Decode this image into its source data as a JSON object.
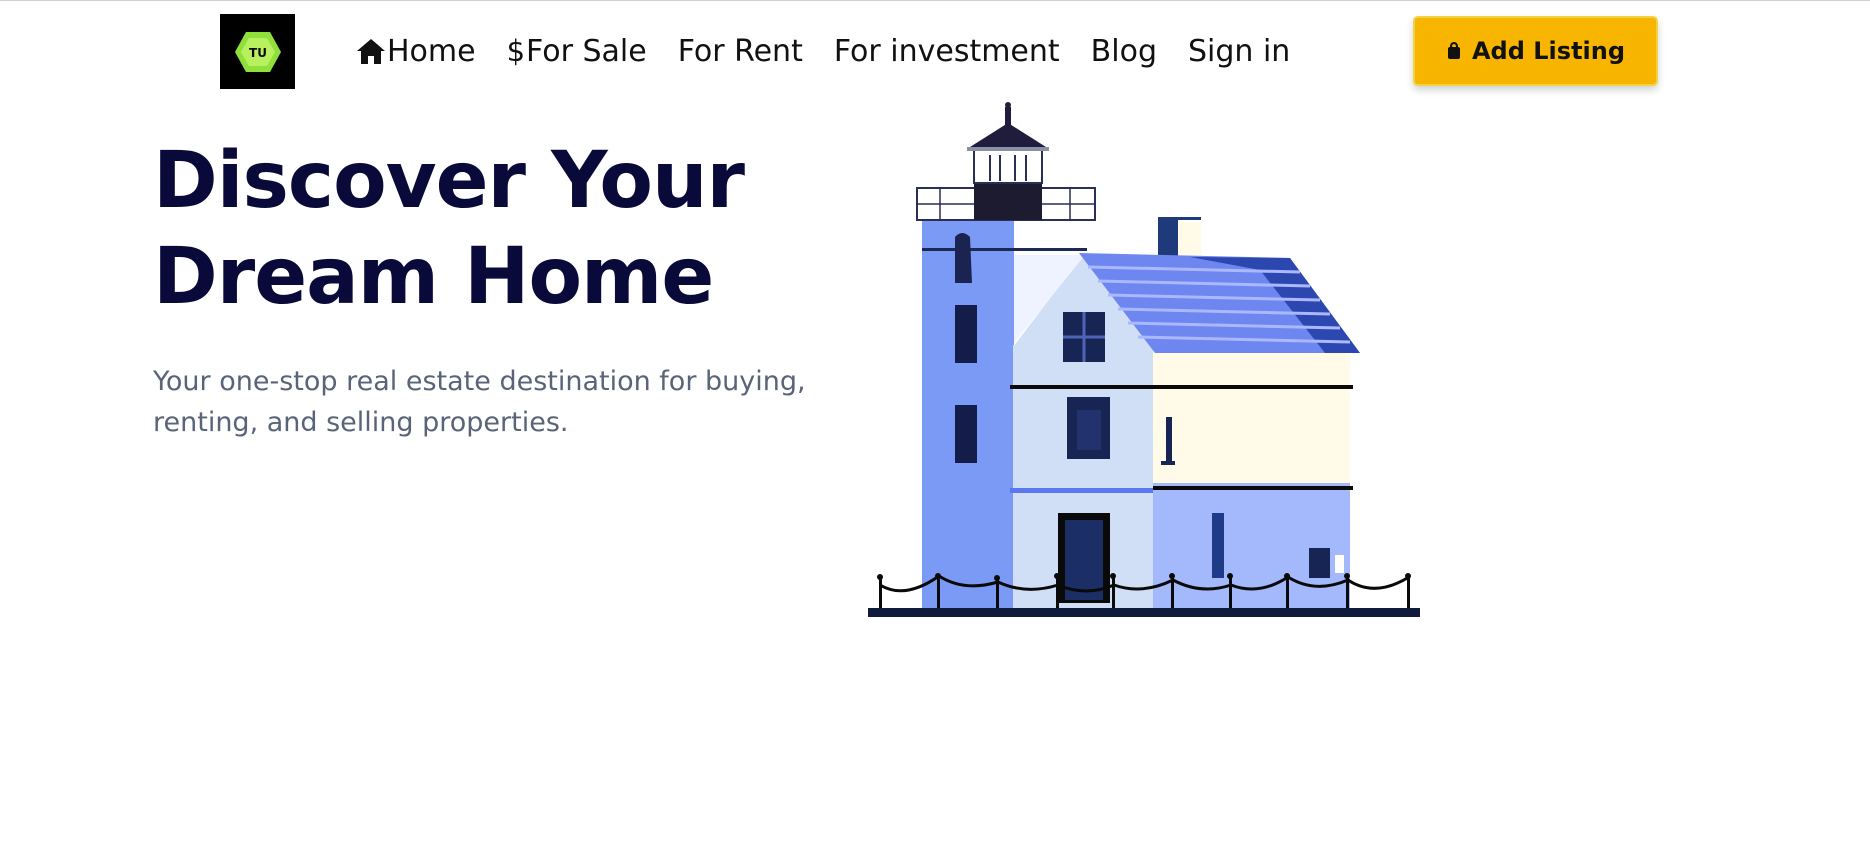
{
  "logo": {
    "text": "TU",
    "icon": "hexagon-logo-icon",
    "bg": "#000000",
    "accent": "#8fe03a"
  },
  "nav": {
    "items": [
      {
        "label": "Home",
        "icon": "home-icon"
      },
      {
        "label": "For Sale",
        "icon": "dollar-icon",
        "prefix": "$"
      },
      {
        "label": "For Rent"
      },
      {
        "label": "For investment"
      },
      {
        "label": "Blog"
      },
      {
        "label": "Sign in"
      }
    ]
  },
  "add_listing": {
    "label": "Add Listing",
    "icon": "shopping-bag-icon",
    "color": "#f7b500"
  },
  "hero": {
    "title_line1": "Discover Your",
    "title_line2": "Dream Home",
    "subtitle": "Your one-stop real estate destination for buying, renting, and selling properties.",
    "title_color": "#0a0a3a",
    "illustration": "lighthouse-house-illustration"
  }
}
